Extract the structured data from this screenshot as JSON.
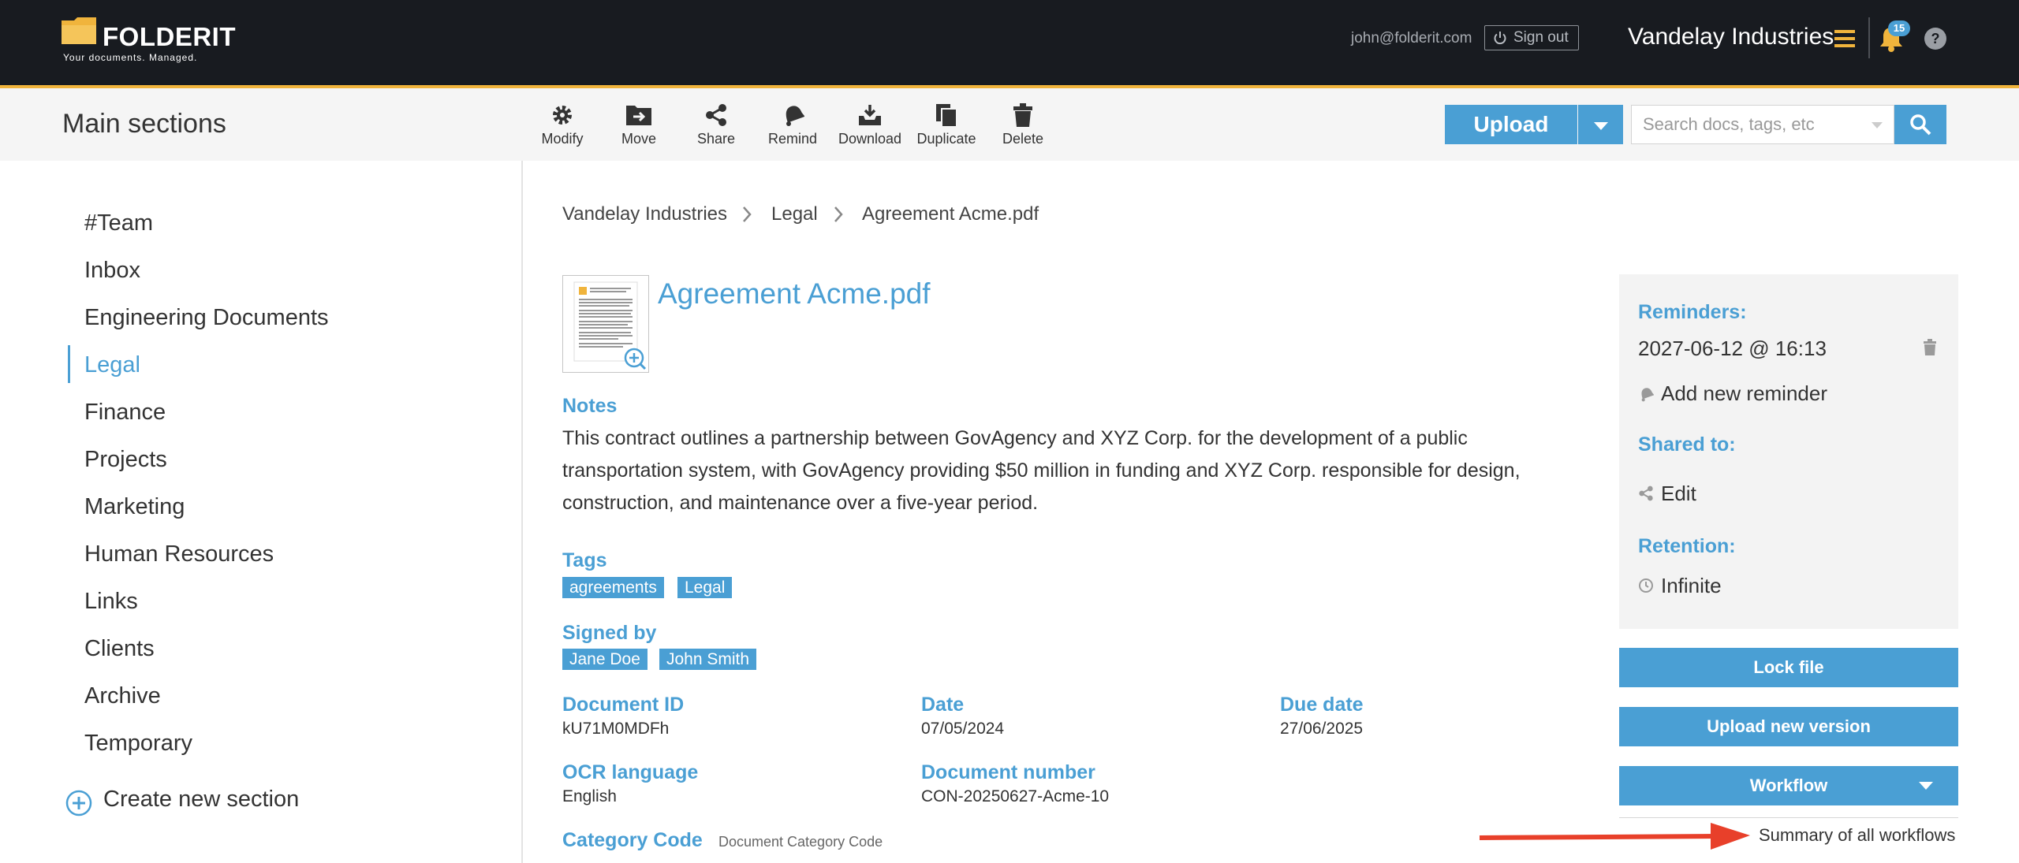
{
  "header": {
    "logo_name": "FOLDERIT",
    "logo_tagline": "Your documents. Managed.",
    "user_email": "john@folderit.com",
    "signout_label": "Sign out",
    "company": "Vandelay Industries",
    "notifications_count": "15",
    "help_label": "?",
    "accent_color": "#f0b43c"
  },
  "toolbar": {
    "section_title": "Main sections",
    "tools": [
      "Modify",
      "Move",
      "Share",
      "Remind",
      "Download",
      "Duplicate",
      "Delete"
    ],
    "upload_label": "Upload",
    "search_placeholder": "Search docs, tags, etc"
  },
  "sidebar": {
    "items": [
      "#Team",
      "Inbox",
      "Engineering Documents",
      "Legal",
      "Finance",
      "Projects",
      "Marketing",
      "Human Resources",
      "Links",
      "Clients",
      "Archive",
      "Temporary"
    ],
    "active_item": "Legal",
    "create_label": "Create new section"
  },
  "breadcrumb": [
    "Vandelay Industries",
    "Legal",
    "Agreement Acme.pdf"
  ],
  "document": {
    "title": "Agreement Acme.pdf",
    "notes_label": "Notes",
    "notes_text": "This contract outlines a partnership between GovAgency and XYZ Corp. for the development of a public transportation system, with GovAgency providing $50 million in funding and XYZ Corp. responsible for design, construction, and maintenance over a five-year period.",
    "tags_label": "Tags",
    "tags": [
      "agreements",
      "Legal"
    ],
    "signed_by_label": "Signed by",
    "signed_by": [
      "Jane Doe",
      "John Smith"
    ],
    "document_id_label": "Document ID",
    "document_id": "kU71M0MDFh",
    "date_label": "Date",
    "date": "07/05/2024",
    "due_date_label": "Due date",
    "due_date": "27/06/2025",
    "ocr_language_label": "OCR language",
    "ocr_language": "English",
    "document_number_label": "Document number",
    "document_number": "CON-20250627-Acme-10",
    "category_code_label": "Category Code",
    "category_code_hint": "Document Category Code"
  },
  "right_panel": {
    "reminders_label": "Reminders:",
    "reminder_value": "2027-06-12 @ 16:13",
    "add_reminder_label": "Add new reminder",
    "shared_to_label": "Shared to:",
    "edit_label": "Edit",
    "retention_label": "Retention:",
    "retention_value": "Infinite",
    "lock_label": "Lock file",
    "upload_version_label": "Upload new version",
    "workflow_label": "Workflow",
    "summary_label": "Summary of all workflows"
  },
  "colors": {
    "primary": "#4a9fd4",
    "topbar": "#181b20",
    "annotation_arrow": "#e8402a"
  }
}
